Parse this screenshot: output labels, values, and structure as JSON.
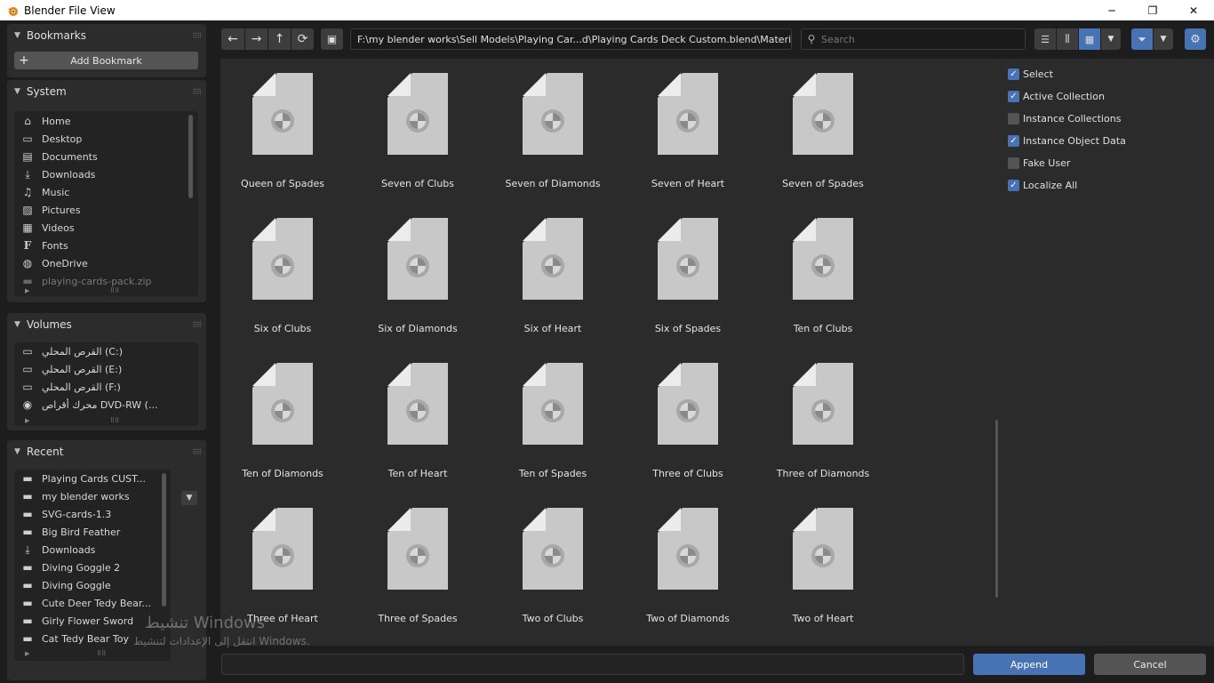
{
  "window": {
    "title": "Blender File View",
    "minimize": "─",
    "maximize": "❐",
    "close": "✕"
  },
  "bookmarks": {
    "title": "Bookmarks",
    "add_label": "Add Bookmark"
  },
  "system": {
    "title": "System",
    "items": [
      {
        "label": "Home",
        "icon": "home-icon"
      },
      {
        "label": "Desktop",
        "icon": "desktop-icon"
      },
      {
        "label": "Documents",
        "icon": "documents-icon"
      },
      {
        "label": "Downloads",
        "icon": "download-icon"
      },
      {
        "label": "Music",
        "icon": "music-icon"
      },
      {
        "label": "Pictures",
        "icon": "pictures-icon"
      },
      {
        "label": "Videos",
        "icon": "videos-icon"
      },
      {
        "label": "Fonts",
        "icon": "fonts-icon"
      },
      {
        "label": "OneDrive",
        "icon": "globe-icon"
      },
      {
        "label": "playing-cards-pack.zip",
        "icon": "folder-icon"
      }
    ]
  },
  "volumes": {
    "title": "Volumes",
    "items": [
      {
        "label": "‎القرص المحلي (C:)"
      },
      {
        "label": "‎القرص المحلي (E:)"
      },
      {
        "label": "‎القرص المحلي (F:)"
      },
      {
        "label": "‎محرك أقراص DVD-RW (..."
      }
    ]
  },
  "recent": {
    "title": "Recent",
    "items": [
      {
        "label": "Playing Cards CUST...",
        "icon": "folder-icon"
      },
      {
        "label": "my blender works",
        "icon": "folder-icon"
      },
      {
        "label": "SVG-cards-1.3",
        "icon": "folder-icon"
      },
      {
        "label": "Big Bird Feather",
        "icon": "folder-icon"
      },
      {
        "label": "Downloads",
        "icon": "download-icon"
      },
      {
        "label": "Diving Goggle 2",
        "icon": "folder-icon"
      },
      {
        "label": "Diving Goggle",
        "icon": "folder-icon"
      },
      {
        "label": "Cute Deer Tedy Bear...",
        "icon": "folder-icon"
      },
      {
        "label": "Girly Flower Sword",
        "icon": "folder-icon"
      },
      {
        "label": "Cat Tedy Bear Toy",
        "icon": "folder-icon"
      }
    ]
  },
  "toolbar": {
    "path": "F:\\my blender works\\Sell Models\\Playing Car...d\\Playing Cards Deck Custom.blend\\Material\\",
    "search_placeholder": "Search"
  },
  "files": [
    [
      "Queen of Spades",
      "Seven of Clubs",
      "Seven of Diamonds",
      "Seven of Heart",
      "Seven of Spades"
    ],
    [
      "Six of Clubs",
      "Six of Diamonds",
      "Six of Heart",
      "Six of Spades",
      "Ten of Clubs"
    ],
    [
      "Ten of Diamonds",
      "Ten of Heart",
      "Ten of Spades",
      "Three of Clubs",
      "Three of Diamonds"
    ],
    [
      "Three of Heart",
      "Three of Spades",
      "Two of Clubs",
      "Two of Diamonds",
      "Two of Heart"
    ]
  ],
  "options": [
    {
      "label": "Select",
      "checked": true
    },
    {
      "label": "Active Collection",
      "checked": true
    },
    {
      "label": "Instance Collections",
      "checked": false
    },
    {
      "label": "Instance Object Data",
      "checked": true
    },
    {
      "label": "Fake User",
      "checked": false
    },
    {
      "label": "Localize All",
      "checked": true
    }
  ],
  "bottom": {
    "append_label": "Append",
    "cancel_label": "Cancel",
    "filename_value": ""
  },
  "watermark": {
    "line1": "تنشيط Windows",
    "line2": "انتقل إلى الإعدادات لتنشيط Windows."
  },
  "colors": {
    "accent": "#4772b3",
    "panel": "#2b2b2b",
    "thumb": "#c8c8c8"
  }
}
